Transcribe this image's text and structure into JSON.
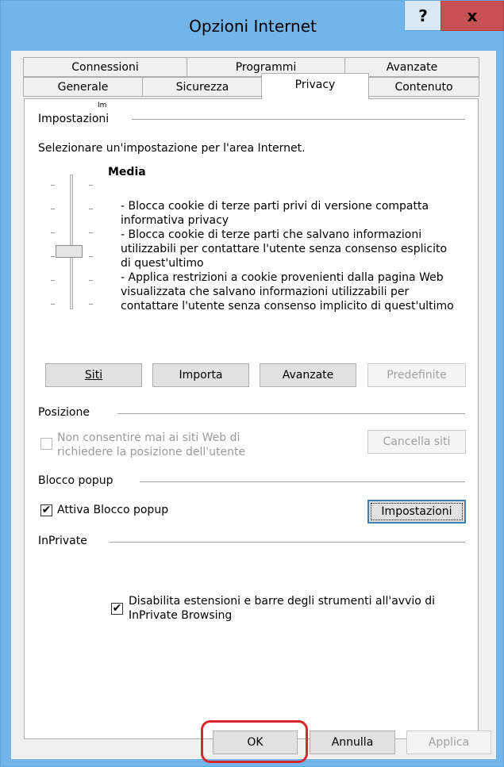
{
  "window": {
    "title": "Opzioni Internet",
    "help_label": "?",
    "close_label": "x"
  },
  "tabs": {
    "row1": [
      "Connessioni",
      "Programmi",
      "Avanzate"
    ],
    "row2": [
      "Generale",
      "Sicurezza",
      "Privacy",
      "Contenuto"
    ],
    "active": "Privacy"
  },
  "privacy": {
    "clipped_text": "Im",
    "settings_group": "Impostazioni",
    "instruction": "Selezionare un'impostazione per l'area Internet.",
    "level_name": "Media",
    "level_description": "- Blocca cookie di terze parti privi di versione compatta\ninformativa privacy\n- Blocca cookie di terze parti che salvano informazioni\nutilizzabili per contattare l'utente senza consenso esplicito\ndi quest'ultimo\n- Applica restrizioni a cookie provenienti dalla pagina Web\nvisualizzata che salvano informazioni utilizzabili per\ncontattare l'utente senza consenso implicito di quest'ultimo",
    "buttons": {
      "sites": "Siti",
      "import": "Importa",
      "advanced": "Avanzate",
      "default": "Predefinite"
    },
    "location_group": "Posizione",
    "location_checkbox": "Non consentire mai ai siti Web di\nrichiedere la posizione dell'utente",
    "location_checked": false,
    "clear_sites": "Cancella siti",
    "popup_group": "Blocco popup",
    "popup_checkbox": "Attiva Blocco popup",
    "popup_checked": true,
    "popup_settings": "Impostazioni",
    "inprivate_group": "InPrivate",
    "inprivate_checkbox": "Disabilita estensioni e barre degli strumenti all'avvio di\nInPrivate Browsing",
    "inprivate_checked": true
  },
  "footer": {
    "ok": "OK",
    "cancel": "Annulla",
    "apply": "Applica"
  },
  "colors": {
    "titlebar": "#71b5ea",
    "close": "#c75050",
    "annotation_circle": "#d9252c"
  }
}
